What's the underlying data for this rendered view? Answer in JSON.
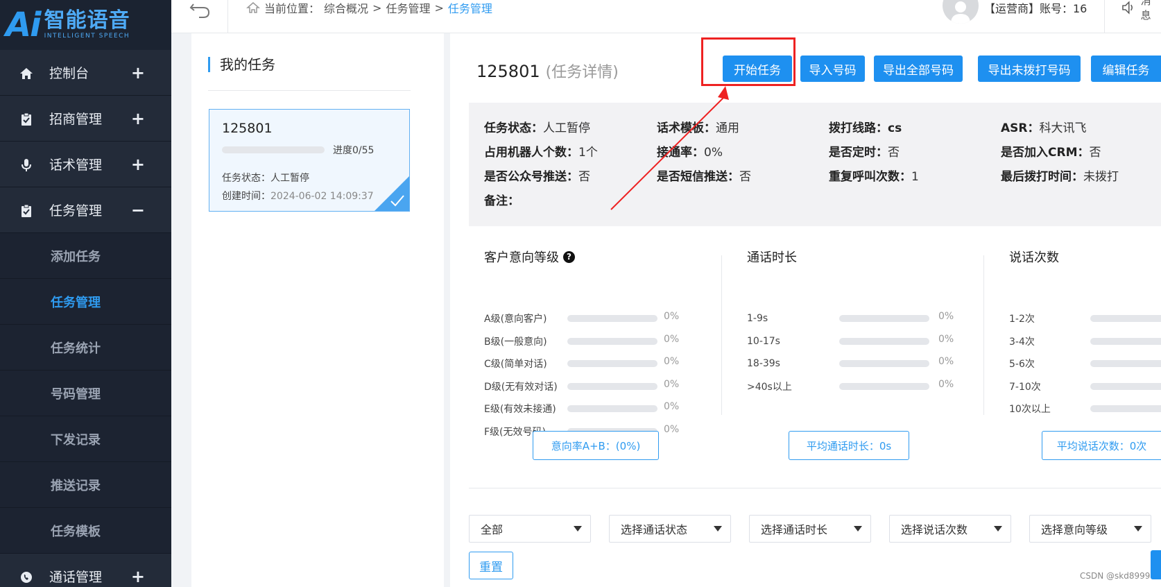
{
  "logo": {
    "ai": "Ai",
    "cn": "智能语音",
    "en": "INTELLIGENT SPEECH"
  },
  "sidebar": {
    "items": [
      {
        "label": "控制台",
        "toggle": "+",
        "icon": "home-icon"
      },
      {
        "label": "招商管理",
        "toggle": "+",
        "icon": "clipboard-icon"
      },
      {
        "label": "话术管理",
        "toggle": "+",
        "icon": "microphone-icon"
      },
      {
        "label": "任务管理",
        "toggle": "−",
        "icon": "clipboard-icon"
      }
    ],
    "sub_items": [
      {
        "label": "添加任务"
      },
      {
        "label": "任务管理"
      },
      {
        "label": "任务统计"
      },
      {
        "label": "号码管理"
      },
      {
        "label": "下发记录"
      },
      {
        "label": "推送记录"
      },
      {
        "label": "任务模板"
      }
    ],
    "last_item": {
      "label": "通话管理",
      "toggle": "+",
      "icon": "phone-call-icon"
    }
  },
  "topbar": {
    "breadcrumb_prefix": "当前位置：",
    "crumb1": "综合概况",
    "sep": ">",
    "crumb2": "任务管理",
    "crumb3": "任务管理",
    "account": "【运营商】账号：16",
    "message": "消息"
  },
  "left_panel": {
    "title": "我的任务",
    "card": {
      "name": "125801",
      "progress_text": "进度0/55",
      "progress_fraction": 0,
      "status_label": "任务状态：",
      "status_value": "人工暂停",
      "created_label": "创建时间：",
      "created_value": "2024-06-02 14:09:37"
    }
  },
  "main": {
    "title": "125801",
    "subtitle": "(任务详情)",
    "buttons": {
      "start": "开始任务",
      "import": "导入号码",
      "export_all": "导出全部号码",
      "export_undialed": "导出未拨打号码",
      "edit": "编辑任务"
    },
    "info": {
      "status_k": "任务状态：",
      "status_v": "人工暂停",
      "template_k": "话术模板：",
      "template_v": "通用",
      "line_k": "拨打线路：",
      "line_v": "cs",
      "asr_k": "ASR：",
      "asr_v": "科大讯飞",
      "robots_k": "占用机器人个数：",
      "robots_v": "1个",
      "rate_k": "接通率：",
      "rate_v": "0%",
      "timed_k": "是否定时：",
      "timed_v": "否",
      "crm_k": "是否加入CRM：",
      "crm_v": "否",
      "wechat_k": "是否公众号推送：",
      "wechat_v": "否",
      "sms_k": "是否短信推送：",
      "sms_v": "否",
      "redial_k": "重复呼叫次数：",
      "redial_v": "1",
      "last_k": "最后拨打时间：",
      "last_v": "未拨打",
      "remark_k": "备注：",
      "remark_v": ""
    },
    "intent": {
      "title": "客户意向等级",
      "rows": [
        {
          "label": "A级(意向客户)",
          "pct": "0%"
        },
        {
          "label": "B级(一般意向)",
          "pct": "0%"
        },
        {
          "label": "C级(简单对话)",
          "pct": "0%"
        },
        {
          "label": "D级(无有效对话)",
          "pct": "0%"
        },
        {
          "label": "E级(有效未接通)",
          "pct": "0%"
        },
        {
          "label": "F级(无效号码)",
          "pct": "0%"
        }
      ]
    },
    "duration": {
      "title": "通话时长",
      "rows": [
        {
          "label": "1-9s",
          "pct": "0%"
        },
        {
          "label": "10-17s",
          "pct": "0%"
        },
        {
          "label": "18-39s",
          "pct": "0%"
        },
        {
          "label": ">40s以上",
          "pct": "0%"
        }
      ]
    },
    "turns": {
      "title": "说话次数",
      "rows": [
        {
          "label": "1-2次"
        },
        {
          "label": "3-4次"
        },
        {
          "label": "5-6次"
        },
        {
          "label": "7-10次"
        },
        {
          "label": "10次以上"
        }
      ]
    },
    "summary": {
      "intent_rate": "意向率A+B：(0%)",
      "avg_duration": "平均通话时长：0s",
      "avg_turns": "平均说话次数：0次"
    },
    "filters": {
      "all": "全部",
      "call_status": "选择通话状态",
      "call_duration": "选择通话时长",
      "turns": "选择说话次数",
      "intent": "选择意向等级"
    },
    "reset": "重置"
  },
  "watermark": "CSDN @skd8999",
  "colors": {
    "accent": "#1e90f0",
    "sidebar_bg": "#1b2331",
    "highlight_red": "#ee2222"
  }
}
